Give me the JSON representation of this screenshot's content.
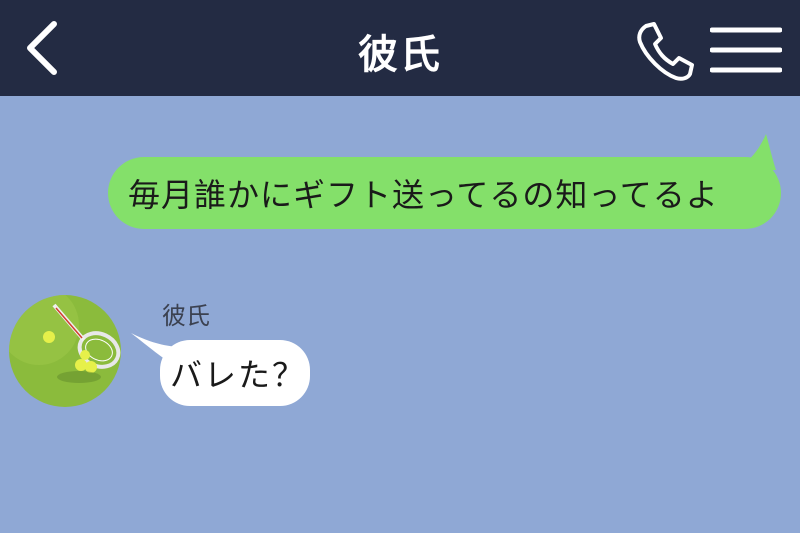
{
  "header": {
    "title": "彼氏",
    "back_icon": "chevron-left-icon",
    "call_icon": "phone-icon",
    "menu_icon": "hamburger-menu-icon",
    "background_color": "#232b43"
  },
  "chat": {
    "background_color": "#8fa8d5",
    "messages": [
      {
        "direction": "outgoing",
        "text": "毎月誰かにギフト送ってるの知ってるよ",
        "bubble_color": "#84e06a"
      },
      {
        "direction": "incoming",
        "sender": "彼氏",
        "avatar": "tennis-racket-avatar",
        "text": "バレた？",
        "bubble_color": "#ffffff"
      }
    ]
  }
}
